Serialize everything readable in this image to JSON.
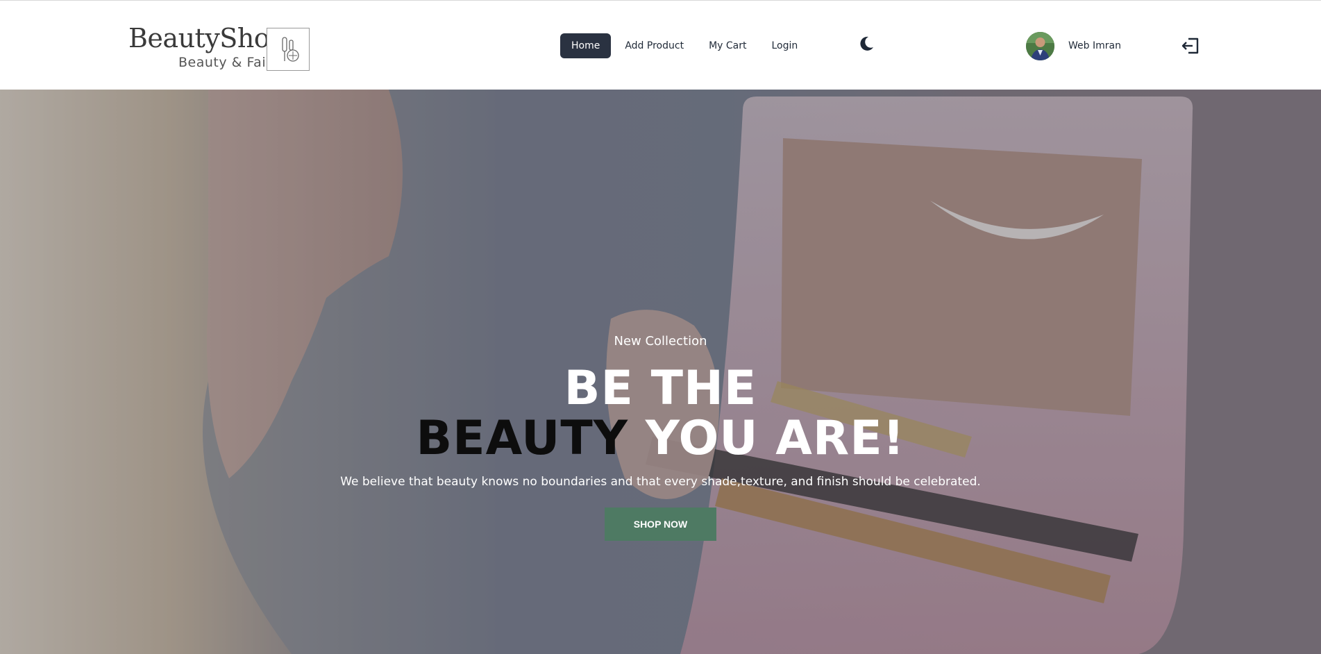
{
  "brand": {
    "title": "BeautyShop",
    "tagline": "Beauty & Fair"
  },
  "nav": {
    "items": [
      {
        "label": "Home",
        "active": true
      },
      {
        "label": "Add Product",
        "active": false
      },
      {
        "label": "My Cart",
        "active": false
      },
      {
        "label": "Login",
        "active": false
      }
    ],
    "theme_icon": "moon-icon",
    "logout_icon": "logout-icon"
  },
  "user": {
    "name": "Web Imran"
  },
  "hero": {
    "eyebrow": "New Collection",
    "line1": "BE THE",
    "line2_dark": "BEAUTY",
    "line2_light": "YOU ARE!",
    "description": "We believe that beauty knows no boundaries and that every shade,texture, and finish should be celebrated.",
    "cta_label": "SHOP NOW"
  },
  "colors": {
    "active_nav_bg": "#2a3241",
    "cta_bg": "#4e7a63",
    "hero_text": "#ffffff",
    "hero_dark_text": "#0d0d0d"
  }
}
